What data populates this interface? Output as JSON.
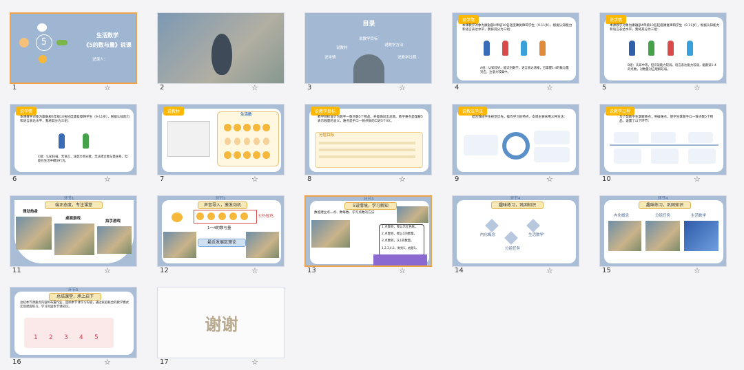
{
  "slides": [
    {
      "num": "1",
      "title": "生活数学",
      "subtitle": "《5的数与量》说课",
      "presenter": "说课人：",
      "big_number": "5"
    },
    {
      "num": "2"
    },
    {
      "num": "3",
      "title": "目录",
      "items": [
        "说教学目标",
        "说教学方法",
        "说教材",
        "说教学过程",
        "说学情"
      ]
    },
    {
      "num": "4",
      "tag": "说学情",
      "text": "本课教学对象为康融部4年级10名轻度康复障碍学生（9-11岁），根据认知能力和语言表达水平，我将其分为三组：",
      "note": "A组：认知较好、能识别数字，语言表达清晰，已掌握1-4的数与量对应，注意力较集中。"
    },
    {
      "num": "5",
      "tag": "说学情",
      "text": "本课教学对象为康融部4年级10名轻度康复障碍学生（9-11岁），根据认知能力和语言表达水平，我将其分为三组：",
      "note": "B组：认知中等，但识读能力较弱，语言表达能力较弱，能跟读1-4的点数，对数量对应理解较弱。"
    },
    {
      "num": "6",
      "tag": "说学情",
      "text": "本课教学对象为康融部4年级10名轻度康复障碍学生（9-11岁），根据认知能力和语言表达水平，我将其分为三组：",
      "note": "C组：认知较弱，无语言，注意力易分散，无法建立数与量关系，但能在生活中模仿行为。"
    },
    {
      "num": "7",
      "tag": "说教材",
      "card_title": "生活数"
    },
    {
      "num": "8",
      "tag": "说教学目标",
      "text": "教学目标设计为数字一数点数5个物品，并能确说出总数。教学重点是理解5表示数量的含义，难点是手口一致点数的口述5个XX。",
      "box_title": "分层目标"
    },
    {
      "num": "9",
      "tag": "说教法学法",
      "text": "结合我班学生视觉优先，操作学习的特点，本课主要采用三种方法："
    },
    {
      "num": "10",
      "tag": "说教学过程",
      "text": "为了帮助学生掌握重点，突破难点，使学生掌握手口一致点数5个物品，设置了以下环节："
    },
    {
      "num": "11",
      "tab": "环节1",
      "title": "端正态度，专注课堂",
      "labels": [
        "律动热身",
        "桌面游戏",
        "拍手游戏"
      ]
    },
    {
      "num": "12",
      "tab": "环节2",
      "title": "声音导入，激发动机",
      "chick_label": "5只母鸡",
      "bottom": [
        "1一4的数与量",
        "最近发展区理论"
      ]
    },
    {
      "num": "13",
      "tab": "环节3",
      "title": "5设情境，学习新知",
      "text": "数感建立点一点、数每数、学习点数的方法",
      "card": [
        "1.点数到，我认示红色框。",
        "2.点数到，我认1的数量。",
        "3.点数到，认1的数量。",
        "1,2,3,4,5，数到5，就是5。"
      ]
    },
    {
      "num": "14",
      "tab": "环节4",
      "title": "趣味练习，巩固知识",
      "labels": [
        "内化概念",
        "生活数学",
        "分组任务"
      ]
    },
    {
      "num": "15",
      "tab": "环节4",
      "title": "趣味练习，巩固知识",
      "labels": [
        "内化概念",
        "分组任务",
        "生活数学"
      ]
    },
    {
      "num": "16",
      "tab": "环节5",
      "title": "总结课堂，承上启下",
      "text": "总结本节课重点内容和布置作业，回顾本节课学习内容，通过家庭联合的教学模式实现课后练习，学习巩固本节课知识。",
      "numbers": [
        "1",
        "2",
        "3",
        "4",
        "5"
      ]
    },
    {
      "num": "17",
      "text": "谢谢"
    }
  ],
  "colors": {
    "background": "#f4f4f6",
    "slide_blue": "#a9bdd6",
    "accent_orange": "#ffb800",
    "selected_border": "#f0a24a"
  },
  "star_icon": "☆"
}
